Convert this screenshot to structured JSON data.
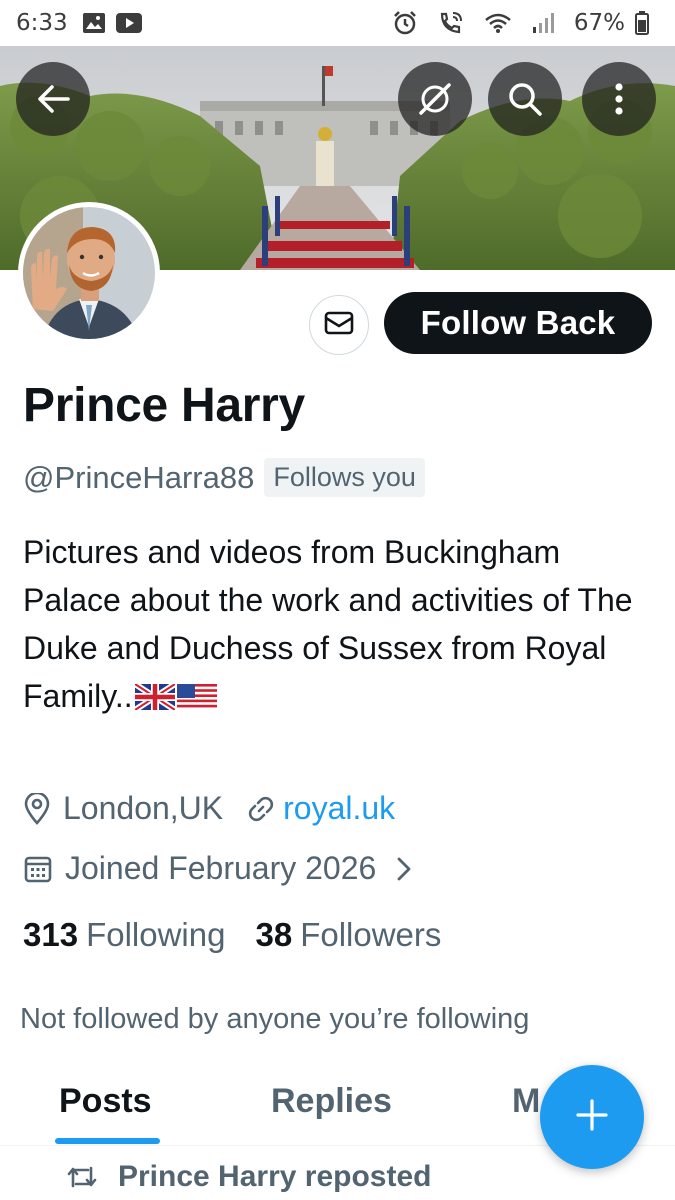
{
  "status_bar": {
    "time": "6:33",
    "battery": "67%",
    "icons": [
      "gallery-icon",
      "youtube-icon",
      "alarm-icon",
      "wifi-call-icon",
      "wifi-icon",
      "signal-icon",
      "battery-icon"
    ]
  },
  "banner": {
    "buttons": [
      "back-arrow-icon",
      "grok-icon",
      "search-icon",
      "more-icon"
    ]
  },
  "profile": {
    "name": "Prince Harry",
    "handle": "@PrinceHarra88",
    "follows_you": "Follows you",
    "bio": "Pictures and videos from Buckingham Palace about the work and activities of The Duke and Duchess of Sussex from Royal Family..",
    "location": "London,UK",
    "website": "royal.uk",
    "joined": "Joined February 2026",
    "following_count": "313",
    "following_label": "Following",
    "followers_count": "38",
    "followers_label": "Followers",
    "not_followed": "Not followed by anyone you’re following"
  },
  "actions": {
    "follow_back": "Follow Back"
  },
  "tabs": [
    {
      "label": "Posts",
      "active": true
    },
    {
      "label": "Replies",
      "active": false
    },
    {
      "label": "M",
      "active": false
    }
  ],
  "feed": {
    "repost_text": "Prince Harry reposted"
  },
  "colors": {
    "accent": "#1d9bf0",
    "text_primary": "#0f1419",
    "text_secondary": "#536471"
  }
}
